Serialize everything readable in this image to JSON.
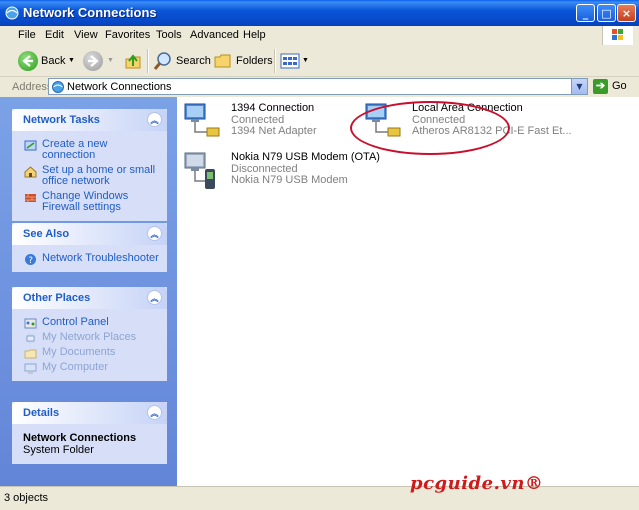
{
  "window": {
    "title": "Network Connections"
  },
  "menu": {
    "items": [
      "File",
      "Edit",
      "View",
      "Favorites",
      "Tools",
      "Advanced",
      "Help"
    ]
  },
  "toolbar": {
    "back_label": "Back",
    "search_label": "Search",
    "folders_label": "Folders"
  },
  "address": {
    "label": "Address",
    "value": "Network Connections",
    "go_label": "Go"
  },
  "tasks": {
    "network_tasks": {
      "title": "Network Tasks",
      "items": [
        "Create a new connection",
        "Set up a home or small office network",
        "Change Windows Firewall settings"
      ]
    },
    "see_also": {
      "title": "See Also",
      "items": [
        "Network Troubleshooter"
      ]
    },
    "other_places": {
      "title": "Other Places",
      "items": [
        "Control Panel",
        "My Network Places",
        "My Documents",
        "My Computer"
      ]
    },
    "details": {
      "title": "Details",
      "name": "Network Connections",
      "type": "System Folder"
    }
  },
  "connections": [
    {
      "name": "1394 Connection",
      "status": "Connected",
      "device": "1394 Net Adapter"
    },
    {
      "name": "Local Area Connection",
      "status": "Connected",
      "device": "Atheros AR8132 PCI-E Fast Et..."
    },
    {
      "name": "Nokia N79 USB Modem (OTA)",
      "status": "Disconnected",
      "device": "Nokia N79 USB Modem"
    }
  ],
  "status_bar": {
    "text": "3 objects"
  },
  "watermark": {
    "text": "pcguide.vn®"
  },
  "colors": {
    "title_bar": "#0a55d8",
    "task_link": "#215dc6",
    "highlight_circle": "#c8102e",
    "brand": "#d11a1a"
  },
  "icons": {
    "window": "network-folder-icon",
    "connection": "network-adapter-icon",
    "modem": "modem-icon"
  }
}
